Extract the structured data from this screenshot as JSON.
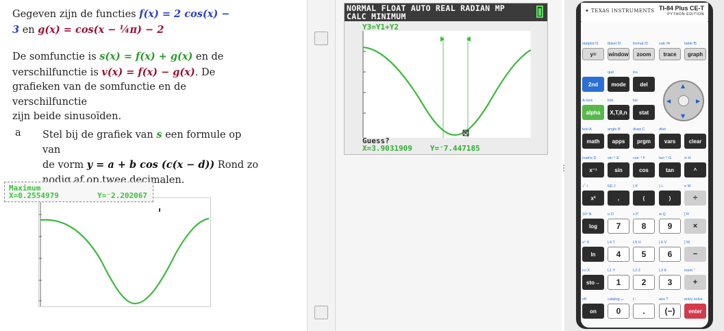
{
  "document": {
    "para1": {
      "t1": "Gegeven zijn de functies ",
      "f": "f(x) = 2 cos(x) −",
      "f2": "3",
      "t2": " en ",
      "g": "g(x) = cos(x − ¼π) − 2"
    },
    "para2": {
      "t1": "De somfunctie is ",
      "s": "s(x)  = f(x)  +  g(x)",
      "t2": " en de",
      "t3": "verschilfunctie is ",
      "v": "v(x)  =  f(x)  −  g(x)",
      "t4": ". De",
      "t5": "grafieken van de somfunctie en de verschilfunctie",
      "t6": "zijn beide sinusoïden."
    },
    "task": {
      "letter": "a",
      "t1": "Stel bij de grafiek van ",
      "s": "s",
      "t2": " een formule op van",
      "t3": "de vorm ",
      "form": "y = a + b cos (c(x − d))",
      "t4": " Rond zo",
      "t5": "nodig af op twee decimalen."
    },
    "mini_status": {
      "title": "Maximum",
      "x": "X=0.2554979",
      "y": "Y=⁻2.202067"
    }
  },
  "screen": {
    "header_line1": "NORMAL FLOAT AUTO REAL RADIAN MP",
    "header_line2": "CALC MINIMUM",
    "function": "Y3=Y1+Y2",
    "guess": "Guess?",
    "x": "X=3.9031909",
    "y": "Y=⁻7.447185"
  },
  "calculator": {
    "brand": "TEXAS INSTRUMENTS",
    "model": "TI-84 Plus CE-T",
    "edition": "PYTHON EDITION",
    "rows": [
      {
        "top": [
          "statplot f1",
          "tblset f2",
          "format f3",
          "calc f4",
          "table f5"
        ],
        "keys": [
          "y=",
          "window",
          "zoom",
          "trace",
          "graph"
        ]
      },
      {
        "top": [
          "",
          "quit",
          "ins"
        ],
        "keys": [
          "2nd",
          "mode",
          "del"
        ]
      },
      {
        "top": [
          "A-lock",
          "link",
          "list"
        ],
        "keys": [
          "alpha",
          "X,T,θ,n",
          "stat"
        ]
      },
      {
        "top": [
          "test A",
          "angle B",
          "draw C",
          "distr",
          ""
        ],
        "keys": [
          "math",
          "apps",
          "prgm",
          "vars",
          "clear"
        ]
      },
      {
        "top": [
          "matrix D",
          "sin⁻¹ E",
          "cos⁻¹ F",
          "tan⁻¹ G",
          "π H"
        ],
        "keys": [
          "x⁻¹",
          "sin",
          "cos",
          "tan",
          "^"
        ]
      },
      {
        "top": [
          "√‾ I",
          "EE J",
          "{ K",
          "} L",
          "e M"
        ],
        "keys": [
          "x²",
          ",",
          "(",
          ")",
          "÷"
        ]
      },
      {
        "top": [
          "10ˣ N",
          "u O",
          "v P",
          "w Q",
          "[ R"
        ],
        "keys": [
          "log",
          "7",
          "8",
          "9",
          "×"
        ]
      },
      {
        "top": [
          "eˣ S",
          "L4 T",
          "L5 U",
          "L6 V",
          "] W"
        ],
        "keys": [
          "ln",
          "4",
          "5",
          "6",
          "−"
        ]
      },
      {
        "top": [
          "rcl X",
          "L1 Y",
          "L2 Z",
          "L3 θ",
          "mem \""
        ],
        "keys": [
          "sto→",
          "1",
          "2",
          "3",
          "+"
        ]
      },
      {
        "top": [
          "off",
          "catalog ⌴",
          "i :",
          "ans ?",
          "entry solve"
        ],
        "keys": [
          "on",
          "0",
          ".",
          "(−)",
          "enter"
        ]
      }
    ]
  },
  "colors": {
    "graph_green": "#3cb93c",
    "key_blue": "#2a6ed6",
    "key_green": "#55b94a",
    "key_red": "#d23b4b"
  }
}
